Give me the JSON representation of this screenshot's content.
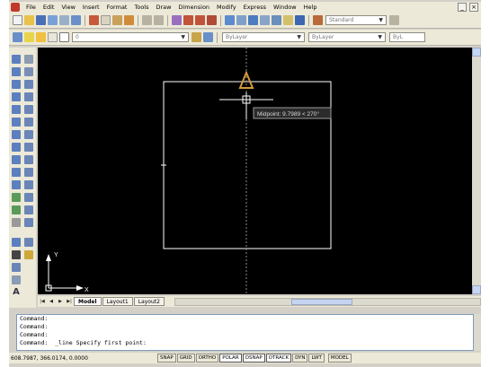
{
  "menubar": {
    "items": [
      "File",
      "Edit",
      "View",
      "Insert",
      "Format",
      "Tools",
      "Draw",
      "Dimension",
      "Modify",
      "Express",
      "Window",
      "Help"
    ]
  },
  "toolbar": {
    "text_style": "Standard",
    "layer": "0",
    "color": "ByLayer",
    "linetype": "ByLayer",
    "lineweight": "ByL"
  },
  "canvas": {
    "tooltip": "Midpoint: 9.7989 < 270°",
    "ucs_x": "X",
    "ucs_y": "Y"
  },
  "tabs": [
    "Model",
    "Layout1",
    "Layout2"
  ],
  "command": {
    "lines": [
      "Command:",
      "Command:",
      "Command:",
      "Command:  _line Specify first point:"
    ]
  },
  "status": {
    "coords": "608.7987, 366.0174, 0.0000",
    "toggles": [
      "SNAP",
      "GRID",
      "ORTHO",
      "POLAR",
      "OSNAP",
      "OTRACK",
      "DYN",
      "LWT"
    ],
    "model": "MODEL"
  },
  "colors": {
    "canvas": "#000000",
    "geometry": "#ffffff",
    "marker": "#d49a3a"
  }
}
